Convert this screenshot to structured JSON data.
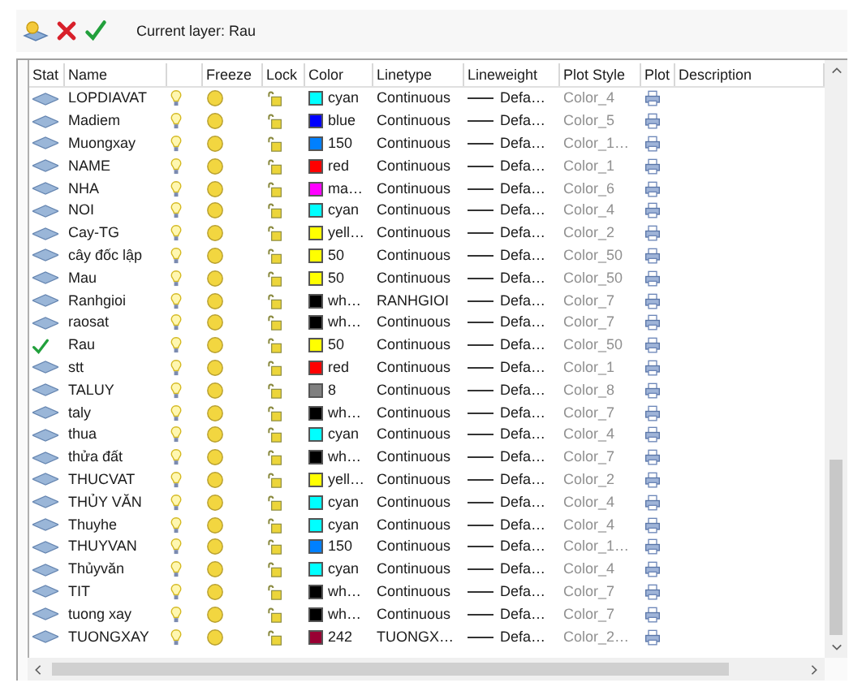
{
  "toolbar": {
    "current_layer": "Current layer: Rau"
  },
  "columns": [
    "Stat",
    "Name",
    "Freeze",
    "Lock",
    "Color",
    "Linetype",
    "Lineweight",
    "Plot Style",
    "Plot",
    "Description"
  ],
  "rows": [
    {
      "name": "LOPDIAVAT",
      "current": false,
      "color": "#00ffff",
      "color_name": "cyan",
      "linetype": "Continuous",
      "lineweight": "Defa…",
      "plot_style": "Color_4"
    },
    {
      "name": "Madiem",
      "current": false,
      "color": "#0000ff",
      "color_name": "blue",
      "linetype": "Continuous",
      "lineweight": "Defa…",
      "plot_style": "Color_5"
    },
    {
      "name": "Muongxay",
      "current": false,
      "color": "#0080ff",
      "color_name": "150",
      "linetype": "Continuous",
      "lineweight": "Defa…",
      "plot_style": "Color_1…"
    },
    {
      "name": "NAME",
      "current": false,
      "color": "#ff0000",
      "color_name": "red",
      "linetype": "Continuous",
      "lineweight": "Defa…",
      "plot_style": "Color_1"
    },
    {
      "name": "NHA",
      "current": false,
      "color": "#ff00ff",
      "color_name": "ma…",
      "linetype": "Continuous",
      "lineweight": "Defa…",
      "plot_style": "Color_6"
    },
    {
      "name": "NOI",
      "current": false,
      "color": "#00ffff",
      "color_name": "cyan",
      "linetype": "Continuous",
      "lineweight": "Defa…",
      "plot_style": "Color_4"
    },
    {
      "name": "Cay-TG",
      "current": false,
      "color": "#ffff00",
      "color_name": "yell…",
      "linetype": "Continuous",
      "lineweight": "Defa…",
      "plot_style": "Color_2"
    },
    {
      "name": "cây đốc lập",
      "current": false,
      "color": "#ffff00",
      "color_name": "50",
      "linetype": "Continuous",
      "lineweight": "Defa…",
      "plot_style": "Color_50"
    },
    {
      "name": "Mau",
      "current": false,
      "color": "#ffff00",
      "color_name": "50",
      "linetype": "Continuous",
      "lineweight": "Defa…",
      "plot_style": "Color_50"
    },
    {
      "name": "Ranhgioi",
      "current": false,
      "color": "#000000",
      "color_name": "wh…",
      "linetype": "RANHGIOI",
      "lineweight": "Defa…",
      "plot_style": "Color_7"
    },
    {
      "name": "raosat",
      "current": false,
      "color": "#000000",
      "color_name": "wh…",
      "linetype": "Continuous",
      "lineweight": "Defa…",
      "plot_style": "Color_7"
    },
    {
      "name": "Rau",
      "current": true,
      "color": "#ffff00",
      "color_name": "50",
      "linetype": "Continuous",
      "lineweight": "Defa…",
      "plot_style": "Color_50"
    },
    {
      "name": "stt",
      "current": false,
      "color": "#ff0000",
      "color_name": "red",
      "linetype": "Continuous",
      "lineweight": "Defa…",
      "plot_style": "Color_1"
    },
    {
      "name": "TALUY",
      "current": false,
      "color": "#808080",
      "color_name": "8",
      "linetype": "Continuous",
      "lineweight": "Defa…",
      "plot_style": "Color_8"
    },
    {
      "name": "taly",
      "current": false,
      "color": "#000000",
      "color_name": "wh…",
      "linetype": "Continuous",
      "lineweight": "Defa…",
      "plot_style": "Color_7"
    },
    {
      "name": "thua",
      "current": false,
      "color": "#00ffff",
      "color_name": "cyan",
      "linetype": "Continuous",
      "lineweight": "Defa…",
      "plot_style": "Color_4"
    },
    {
      "name": "thửa đất",
      "current": false,
      "color": "#000000",
      "color_name": "wh…",
      "linetype": "Continuous",
      "lineweight": "Defa…",
      "plot_style": "Color_7"
    },
    {
      "name": "THUCVAT",
      "current": false,
      "color": "#ffff00",
      "color_name": "yell…",
      "linetype": "Continuous",
      "lineweight": "Defa…",
      "plot_style": "Color_2"
    },
    {
      "name": "THỦY VĂN",
      "current": false,
      "color": "#00ffff",
      "color_name": "cyan",
      "linetype": "Continuous",
      "lineweight": "Defa…",
      "plot_style": "Color_4"
    },
    {
      "name": "Thuyhe",
      "current": false,
      "color": "#00ffff",
      "color_name": "cyan",
      "linetype": "Continuous",
      "lineweight": "Defa…",
      "plot_style": "Color_4"
    },
    {
      "name": "THUYVAN",
      "current": false,
      "color": "#0080ff",
      "color_name": "150",
      "linetype": "Continuous",
      "lineweight": "Defa…",
      "plot_style": "Color_1…"
    },
    {
      "name": "Thủyvăn",
      "current": false,
      "color": "#00ffff",
      "color_name": "cyan",
      "linetype": "Continuous",
      "lineweight": "Defa…",
      "plot_style": "Color_4"
    },
    {
      "name": "TIT",
      "current": false,
      "color": "#000000",
      "color_name": "wh…",
      "linetype": "Continuous",
      "lineweight": "Defa…",
      "plot_style": "Color_7"
    },
    {
      "name": "tuong xay",
      "current": false,
      "color": "#000000",
      "color_name": "wh…",
      "linetype": "Continuous",
      "lineweight": "Defa…",
      "plot_style": "Color_7"
    },
    {
      "name": "TUONGXAY",
      "current": false,
      "color": "#990033",
      "color_name": "242",
      "linetype": "TUONGX…",
      "lineweight": "Defa…",
      "plot_style": "Color_2…"
    }
  ]
}
